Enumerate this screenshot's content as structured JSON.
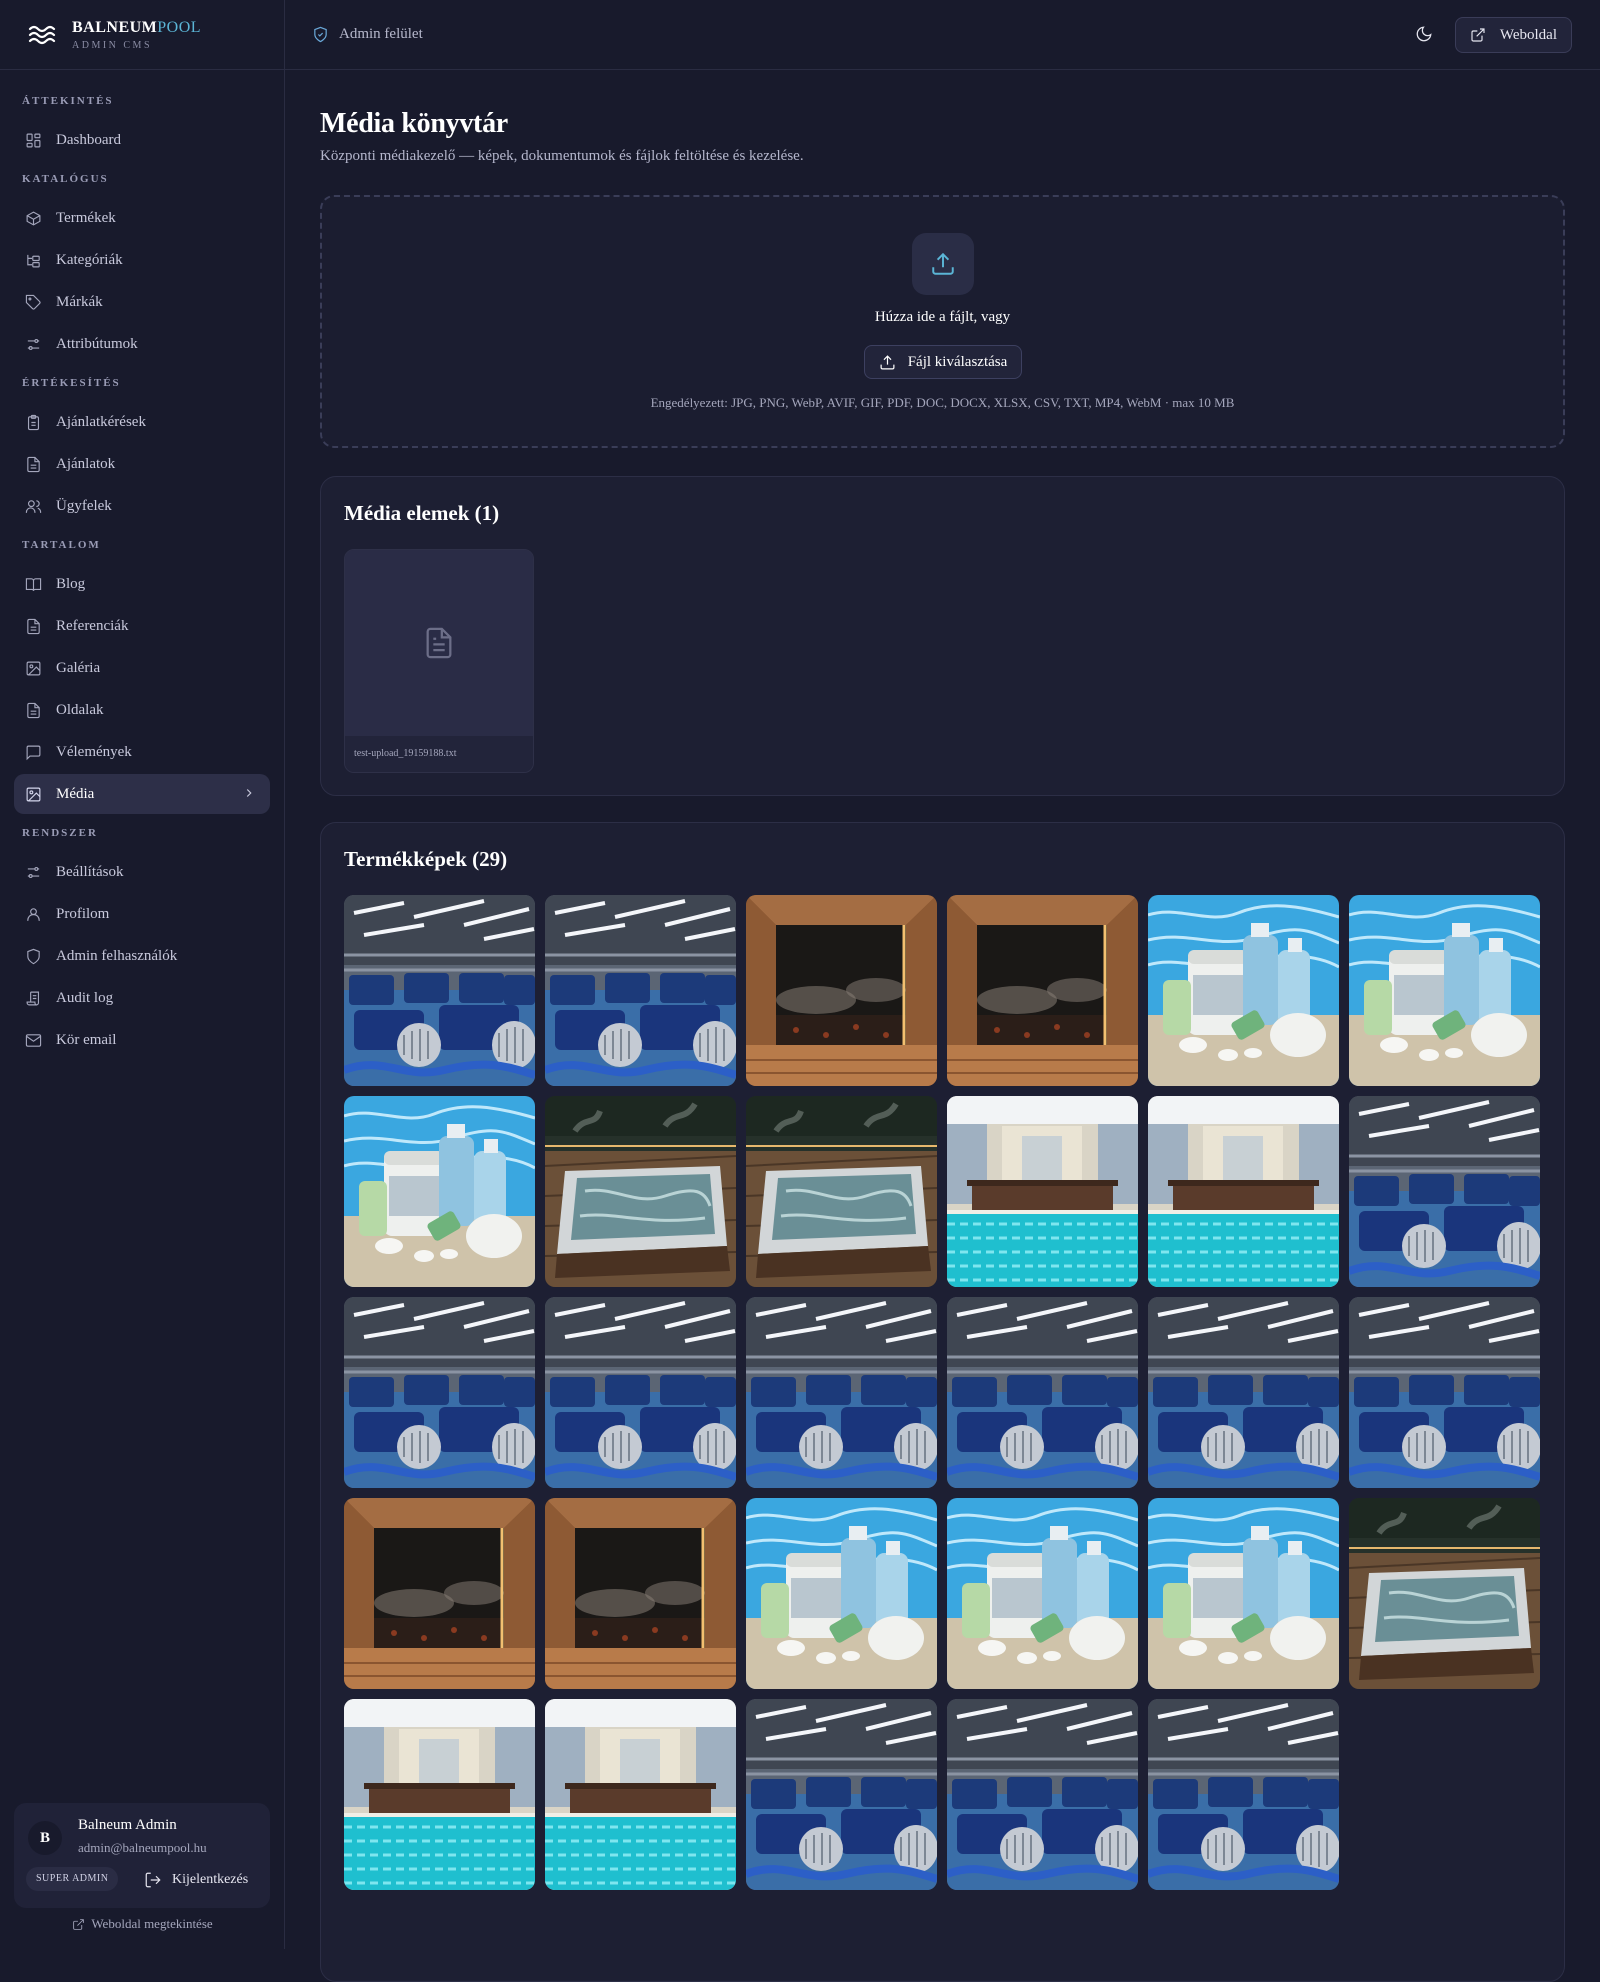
{
  "brand": {
    "name": "BALNEUM",
    "name_accent": "POOL",
    "subtitle": "ADMIN CMS"
  },
  "topbar": {
    "breadcrumb": "Admin felület",
    "website_button": "Weboldal"
  },
  "sidebar": {
    "sections": [
      {
        "label": "ÁTTEKINTÉS",
        "items": [
          {
            "label": "Dashboard",
            "icon": "dashboard-icon"
          }
        ]
      },
      {
        "label": "KATALÓGUS",
        "items": [
          {
            "label": "Termékek",
            "icon": "package-icon"
          },
          {
            "label": "Kategóriák",
            "icon": "folder-tree-icon"
          },
          {
            "label": "Márkák",
            "icon": "tag-icon"
          },
          {
            "label": "Attribútumok",
            "icon": "sliders-icon"
          }
        ]
      },
      {
        "label": "ÉRTÉKESÍTÉS",
        "items": [
          {
            "label": "Ajánlatkérések",
            "icon": "clipboard-icon"
          },
          {
            "label": "Ajánlatok",
            "icon": "document-icon"
          },
          {
            "label": "Ügyfelek",
            "icon": "users-icon"
          }
        ]
      },
      {
        "label": "TARTALOM",
        "items": [
          {
            "label": "Blog",
            "icon": "book-icon"
          },
          {
            "label": "Referenciák",
            "icon": "document-icon"
          },
          {
            "label": "Galéria",
            "icon": "image-icon"
          },
          {
            "label": "Oldalak",
            "icon": "document-icon"
          },
          {
            "label": "Vélemények",
            "icon": "message-icon"
          },
          {
            "label": "Média",
            "icon": "image-icon",
            "active": true
          }
        ]
      },
      {
        "label": "RENDSZER",
        "items": [
          {
            "label": "Beállítások",
            "icon": "sliders-icon"
          },
          {
            "label": "Profilom",
            "icon": "user-icon"
          },
          {
            "label": "Admin felhasználók",
            "icon": "shield-icon"
          },
          {
            "label": "Audit log",
            "icon": "log-icon"
          },
          {
            "label": "Kör email",
            "icon": "mail-icon"
          }
        ]
      }
    ],
    "user": {
      "initial": "B",
      "name": "Balneum Admin",
      "email": "admin@balneumpool.hu",
      "role": "SUPER ADMIN",
      "logout": "Kijelentkezés"
    },
    "site_link": "Weboldal megtekintése"
  },
  "page": {
    "title": "Média könyvtár",
    "subtitle": "Központi médiakezelő — képek, dokumentumok és fájlok feltöltése és kezelése.",
    "upload": {
      "prompt": "Húzza ide a fájlt, vagy",
      "button": "Fájl kiválasztása",
      "allowed": "Engedélyezett: JPG, PNG, WebP, AVIF, GIF, PDF, DOC, DOCX, XLSX, CSV, TXT, MP4, WebM · max 10 MB"
    },
    "media_section": {
      "title": "Média elemek (1)",
      "items": [
        {
          "filename": "test-upload_19159188.txt"
        }
      ]
    },
    "products_section": {
      "title": "Termékképek (29)",
      "images": [
        "pump-room",
        "pump-room",
        "sauna",
        "sauna",
        "chemicals",
        "chemicals",
        "chemicals",
        "hot-tub",
        "hot-tub",
        "indoor-pool",
        "indoor-pool",
        "pump-room",
        "pump-room",
        "pump-room",
        "pump-room",
        "pump-room",
        "pump-room",
        "pump-room",
        "sauna",
        "sauna",
        "chemicals",
        "chemicals",
        "chemicals",
        "hot-tub",
        "indoor-pool",
        "indoor-pool",
        "pump-room",
        "pump-room",
        "pump-room"
      ]
    }
  }
}
